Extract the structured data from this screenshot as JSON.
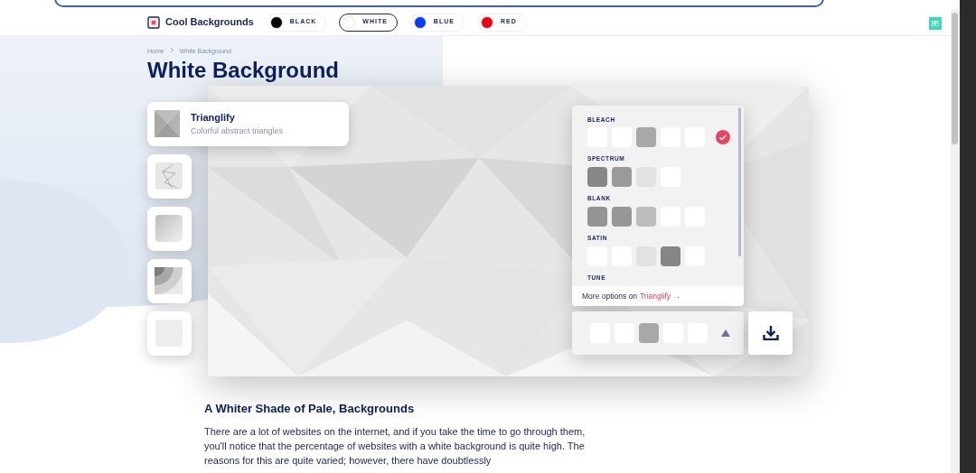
{
  "nav": {
    "brand": "Cool Backgrounds",
    "badge": "æ",
    "colors": [
      {
        "label": "BLACK",
        "color": "#000000",
        "selected": false
      },
      {
        "label": "WHITE",
        "color": "#ffffff",
        "selected": true
      },
      {
        "label": "BLUE",
        "color": "#0a3cf5",
        "selected": false
      },
      {
        "label": "RED",
        "color": "#f00010",
        "selected": false
      }
    ]
  },
  "breadcrumb": [
    "Home",
    "White Background"
  ],
  "title": "White Background",
  "generators": [
    {
      "kind": "triangles",
      "selected": true,
      "name": "Trianglify",
      "description": "Colorful abstract triangles"
    },
    {
      "kind": "lines",
      "selected": false
    },
    {
      "kind": "gradient",
      "selected": false
    },
    {
      "kind": "rings",
      "selected": false
    },
    {
      "kind": "blank",
      "selected": false
    }
  ],
  "palettes": [
    {
      "name": "BLEACH",
      "selected": true,
      "swatches": [
        {
          "color": "#ffffff"
        },
        {
          "color": "#ffffff"
        },
        {
          "color": "#a8a8a8"
        },
        {
          "color": "#ffffff"
        },
        {
          "color": "#ffffff"
        }
      ]
    },
    {
      "name": "SPECTRUM",
      "selected": false,
      "swatches": [
        {
          "color": "#878787"
        },
        {
          "color": "#9a9a9a"
        },
        {
          "color": "#e2e2e2"
        },
        {
          "color": "#ffffff"
        }
      ]
    },
    {
      "name": "BLANK",
      "selected": false,
      "swatches": [
        {
          "color": "#959595"
        },
        {
          "color": "#979797"
        },
        {
          "color": "#bdbdbd"
        },
        {
          "color": "#ffffff"
        },
        {
          "color": "#ffffff"
        }
      ]
    },
    {
      "name": "SATIN",
      "selected": false,
      "swatches": [
        {
          "color": "#ffffff"
        },
        {
          "color": "#ffffff"
        },
        {
          "color": "#e2e2e2"
        },
        {
          "color": "#858585"
        },
        {
          "color": "#ffffff"
        }
      ]
    },
    {
      "name": "TUNE",
      "selected": false
    }
  ],
  "more_options": {
    "text": "More options on",
    "link": "Trianglify →"
  },
  "current_palette": {
    "swatches": [
      {
        "color": "#ffffff"
      },
      {
        "color": "#ffffff"
      },
      {
        "color": "#a8a8a8"
      },
      {
        "color": "#ffffff"
      },
      {
        "color": "#ffffff"
      }
    ]
  },
  "article": {
    "heading": "A Whiter Shade of Pale, Backgrounds",
    "paragraph": "There are a lot of websites on the internet, and if you take the time to go through them, you'll notice that the percentage of websites with a white background is quite high. The reasons for this are quite varied; however, there have doubtlessly"
  }
}
